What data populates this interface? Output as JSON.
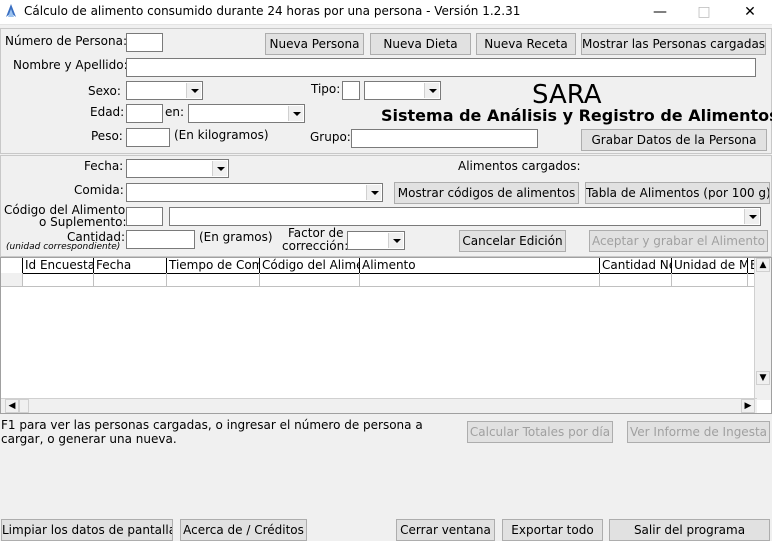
{
  "window": {
    "title": "Cálculo de alimento consumido durante 24 horas por una persona - Versión 1.2.31"
  },
  "person": {
    "numero_label": "Número de Persona:",
    "nombre_label": "Nombre y Apellido:",
    "sexo_label": "Sexo:",
    "tipo_label": "Tipo:",
    "edad_label": "Edad:",
    "en_label": "en:",
    "peso_label": "Peso:",
    "peso_unit": "(En kilogramos)",
    "grupo_label": "Grupo:"
  },
  "person_buttons": {
    "nueva_persona": "Nueva Persona",
    "nueva_dieta": "Nueva Dieta",
    "nueva_receta": "Nueva Receta",
    "mostrar_personas": "Mostrar las Personas cargadas",
    "grabar_persona": "Grabar Datos de la Persona"
  },
  "brand": {
    "name": "SARA",
    "subtitle": "Sistema de Análisis y Registro de Alimentos"
  },
  "food": {
    "fecha_label": "Fecha:",
    "comida_label": "Comida:",
    "codigo_label_1": "Código del Alimento",
    "codigo_label_2": "o Suplemento:",
    "cantidad_label": "Cantidad:",
    "cantidad_sub": "(unidad correspondiente)",
    "cantidad_unit": "(En gramos)",
    "factor_label_1": "Factor de",
    "factor_label_2": "corrección:",
    "cargados_label": "Alimentos cargados:"
  },
  "food_buttons": {
    "mostrar_codigos": "Mostrar códigos de alimentos",
    "tabla_alimentos": "Tabla de Alimentos (por 100 g)",
    "cancelar_edicion": "Cancelar Edición",
    "aceptar_grabar": "Aceptar y grabar el Alimento"
  },
  "table": {
    "columns": [
      "Id Encuesta",
      "Fecha",
      "Tiempo de Com",
      "Código del Alime",
      "Alimento",
      "Cantidad Ne",
      "Unidad de M",
      "E"
    ]
  },
  "status": {
    "message": "F1 para ver las personas cargadas, o ingresar el número de persona a cargar, o generar una nueva."
  },
  "summary_buttons": {
    "calcular_totales": "Calcular Totales por día",
    "ver_informe": "Ver Informe de Ingesta"
  },
  "footer_buttons": {
    "limpiar": "Limpiar los datos de pantalla",
    "acerca": "Acerca de / Créditos",
    "cerrar": "Cerrar ventana",
    "exportar": "Exportar todo",
    "salir": "Salir del programa"
  }
}
